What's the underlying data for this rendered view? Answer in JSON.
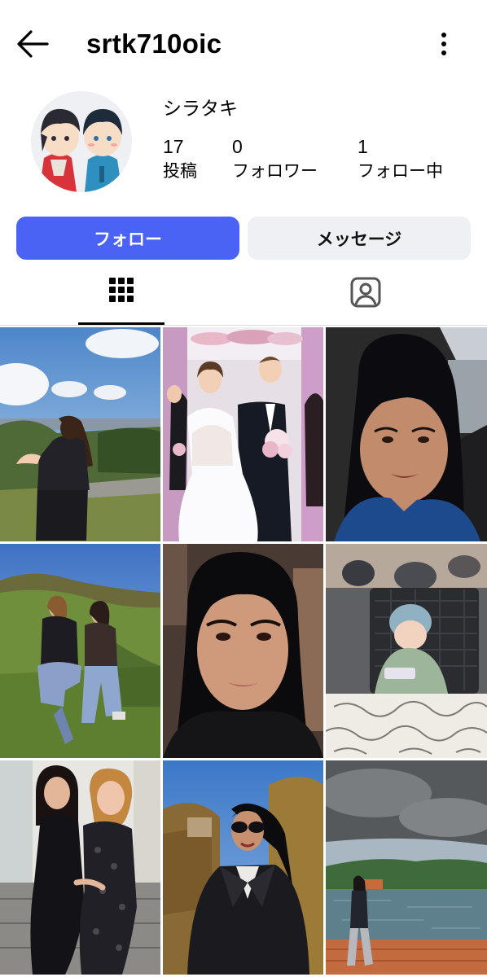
{
  "header": {
    "username": "srtk710oic",
    "back_icon": "arrow-left-icon",
    "menu_icon": "more-vertical-icon"
  },
  "profile": {
    "display_name": "シラタキ",
    "avatar_icon": "cartoon-avatar",
    "stats": {
      "posts": {
        "value": "17",
        "label": "投稿"
      },
      "followers": {
        "value": "0",
        "label": "フォロワー"
      },
      "following": {
        "value": "1",
        "label": "フォロー中"
      }
    }
  },
  "actions": {
    "follow_label": "フォロー",
    "message_label": "メッセージ"
  },
  "tabs": {
    "grid_icon": "grid-icon",
    "tagged_icon": "tagged-person-icon",
    "active": "grid"
  },
  "colors": {
    "primary_button": "#4b63f5",
    "secondary_button": "#eff0f3"
  },
  "posts": [
    {
      "id": "post-1",
      "scene": "woman-overlooking-city"
    },
    {
      "id": "post-2",
      "scene": "wedding-couple"
    },
    {
      "id": "post-3",
      "scene": "car-selfie"
    },
    {
      "id": "post-4",
      "scene": "two-women-on-hill"
    },
    {
      "id": "post-5",
      "scene": "woman-selfie"
    },
    {
      "id": "post-6",
      "scene": "baby-in-chair"
    },
    {
      "id": "post-7",
      "scene": "two-women-posing"
    },
    {
      "id": "post-8",
      "scene": "woman-in-sunglasses-autumn"
    },
    {
      "id": "post-9",
      "scene": "woman-by-lake"
    }
  ]
}
